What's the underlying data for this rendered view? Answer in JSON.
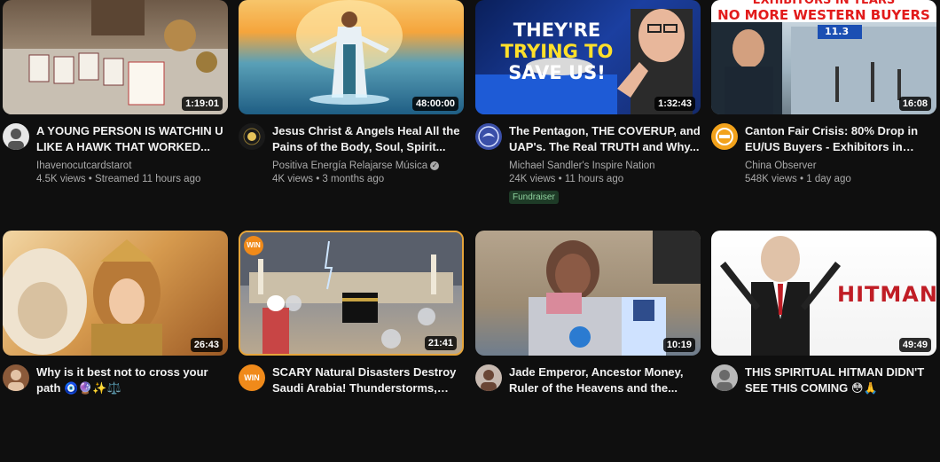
{
  "videos": [
    {
      "title": "A YOUNG PERSON IS WATCHIN U LIKE A HAWK THAT WORKED...",
      "channel": "Ihavenocutcardstarot",
      "stats": "4.5K views • Streamed 11 hours ago",
      "duration": "1:19:01",
      "thumb": "t-tarot",
      "avatar_color": "#e8e8e8",
      "avatar_icon": "person-icon"
    },
    {
      "title": "Jesus Christ & Angels Heal All the Pains of the Body, Soul, Spirit...",
      "channel": "Positiva Energía Relajarse Música",
      "stats": "4K views • 3 months ago",
      "duration": "48:00:00",
      "thumb": "t-jesus",
      "avatar_color": "#1a1a1a",
      "avatar_icon": "sun-icon",
      "verified": true
    },
    {
      "title": "The Pentagon, THE COVERUP, and UAP's. The Real TRUTH and Why...",
      "channel": "Michael Sandler's Inspire Nation",
      "stats": "24K views • 11 hours ago",
      "duration": "1:32:43",
      "thumb": "t-pentagon",
      "avatar_color": "#3a4fa8",
      "avatar_icon": "bird-icon",
      "badge": "Fundraiser",
      "thumb_text_1": "THEY'RE",
      "thumb_text_2": "TRYING TO",
      "thumb_text_3": "SAVE US!"
    },
    {
      "title": "Canton Fair Crisis: 80% Drop in EU/US Buyers - Exhibitors in Tear...",
      "channel": "China Observer",
      "stats": "548K views • 1 day ago",
      "duration": "16:08",
      "thumb": "t-canton",
      "avatar_color": "#f2a21b",
      "avatar_icon": "logo-icon",
      "thumb_text_1": "EXHIBITORS IN TEARS",
      "thumb_text_2": "NO MORE WESTERN BUYERS",
      "thumb_text_3": "11.3"
    },
    {
      "title": "Why is it best not to cross your path 🧿🔮✨⚖️",
      "channel": "",
      "stats": "",
      "duration": "26:43",
      "thumb": "t-lion",
      "avatar_color": "#8b5a3a",
      "avatar_icon": "person-icon"
    },
    {
      "title": "SCARY Natural Disasters Destroy Saudi Arabia! Thunderstorms, Ha...",
      "channel": "",
      "stats": "",
      "duration": "21:41",
      "thumb": "t-saudi",
      "avatar_color": "#f08a1a",
      "avatar_icon": "win-icon",
      "thumb_text_1": "WIN",
      "avatar_text": "WIN"
    },
    {
      "title": "Jade Emperor, Ancestor Money, Ruler of the Heavens and the...",
      "channel": "",
      "stats": "",
      "duration": "10:19",
      "thumb": "t-jade",
      "avatar_color": "#c7b9b0",
      "avatar_icon": "person-icon"
    },
    {
      "title": "THIS SPIRITUAL HITMAN DIDN'T SEE THIS COMING 😳🙏",
      "channel": "",
      "stats": "",
      "duration": "49:49",
      "thumb": "t-hitman",
      "avatar_color": "#b9b9b9",
      "avatar_icon": "person-icon",
      "thumb_text_1": "HITMAN"
    }
  ]
}
